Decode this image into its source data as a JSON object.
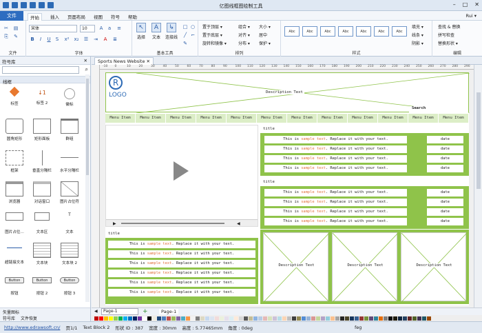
{
  "window": {
    "title": "亿图线框图绘制工具",
    "controls": [
      "–",
      "□",
      "✕"
    ]
  },
  "menu": {
    "file": "文件",
    "tabs": [
      "开始",
      "插入",
      "页面布局",
      "视图",
      "符号",
      "帮助"
    ],
    "user": "Rui ▾"
  },
  "ribbon": {
    "groups": [
      "文件",
      "字体",
      "基本工具",
      "排列",
      "样式",
      "编辑"
    ],
    "font_name": "宋体",
    "font_size": "10",
    "tools": [
      "选择",
      "文本",
      "连接线"
    ],
    "arrange": [
      "置于顶层 ▾",
      "置于底层 ▾",
      "旋转和镜像 ▾",
      "组合 ▾",
      "对齐 ▾",
      "分布 ▾",
      "大小 ▾",
      "居中",
      "保护 ▾"
    ],
    "style_label": "Abc",
    "style_count": 7,
    "fill": "填充 ▾",
    "line": "线条 ▾",
    "shadow": "阴影 ▾",
    "edit": [
      "查找 & 替换",
      "拼写检查",
      "替换形状 ▾"
    ]
  },
  "sidebar": {
    "header": "符号库",
    "category": "线框",
    "shapes": [
      "标签",
      "标签 2",
      "徽标",
      "圆角矩形",
      "矩形面板",
      "群组",
      "框架",
      "垂直分隔栏",
      "水平分隔栏",
      "浏览器",
      "对话窗口",
      "图片占位符",
      "图片占位...",
      "文本区",
      "文本",
      "超链接文本",
      "文本块",
      "文本块 2",
      "按钮",
      "按钮 2",
      "按钮 3"
    ],
    "button_text": "Button",
    "logo_text": "LOGO",
    "library_footer": "矢量图标",
    "bottom_tabs": [
      "符号库",
      "文件恢复"
    ]
  },
  "document": {
    "tab": "Sports News Website",
    "ruler": [
      "-10",
      "0",
      "10",
      "20",
      "30",
      "40",
      "50",
      "60",
      "70",
      "80",
      "90",
      "100",
      "110",
      "120",
      "130",
      "140",
      "150",
      "160",
      "170",
      "180",
      "190",
      "200",
      "210",
      "220",
      "230",
      "240",
      "250",
      "260",
      "270",
      "280",
      "290"
    ]
  },
  "wireframe": {
    "logo": "LOGO",
    "logo_mark": "R",
    "header_desc": "Description Text",
    "search": "Search",
    "menu_item": "Menu Item",
    "menu_count": 12,
    "title": "title",
    "sample_prefix": "This is ",
    "sample_highlight": "sample text",
    "sample_suffix": ". Replace it with your text.",
    "date": "date",
    "description": "Description Text"
  },
  "pagebar": {
    "page_select": "Page-1",
    "page_tab": "Page-1",
    "add": "+"
  },
  "status": {
    "url": "http://www.edrawsoft.cn/",
    "page": "页1/1",
    "shape": "Text Block 2",
    "shape_id": "形状 ID : 387",
    "width": "宽度 : 30mm",
    "height": "高度 : 5.77465mm",
    "angle": "角度 : 0deg",
    "right": "feg"
  },
  "colors": [
    "#c00000",
    "#ff0000",
    "#ffc000",
    "#ffff00",
    "#92d050",
    "#00b050",
    "#00b0f0",
    "#0070c0",
    "#002060",
    "#7030a0",
    "#ffffff",
    "#000000",
    "#eeece1",
    "#1f497d",
    "#4f81bd",
    "#c0504d",
    "#9bbb59",
    "#8064a2",
    "#4bacc6",
    "#f79646",
    "#f2f2f2",
    "#7f7f7f",
    "#ddd9c3",
    "#c6d9f0",
    "#dbe5f1",
    "#f2dcdb",
    "#ebf1dd",
    "#e5e0ec",
    "#dbeef3",
    "#fdeada",
    "#d8d8d8",
    "#595959",
    "#c4bd97",
    "#8db3e2",
    "#b8cce4",
    "#e5b9b7",
    "#d7e3bc",
    "#ccc1d9",
    "#b7dde8",
    "#fbd5b5",
    "#bfbfbf",
    "#3f3f3f",
    "#938953",
    "#548dd4",
    "#95b3d7",
    "#d99694",
    "#c3d69b",
    "#b2a2c7",
    "#92cddc",
    "#fac08f",
    "#a5a5a5",
    "#262626",
    "#494429",
    "#17365d",
    "#366092",
    "#953734",
    "#76923c",
    "#5f497a",
    "#31859b",
    "#e36c09",
    "#7f7f7f",
    "#0c0c0c",
    "#1d1b10",
    "#0f243e",
    "#244061",
    "#632423",
    "#4f6128",
    "#3f3151",
    "#205867",
    "#974806"
  ]
}
